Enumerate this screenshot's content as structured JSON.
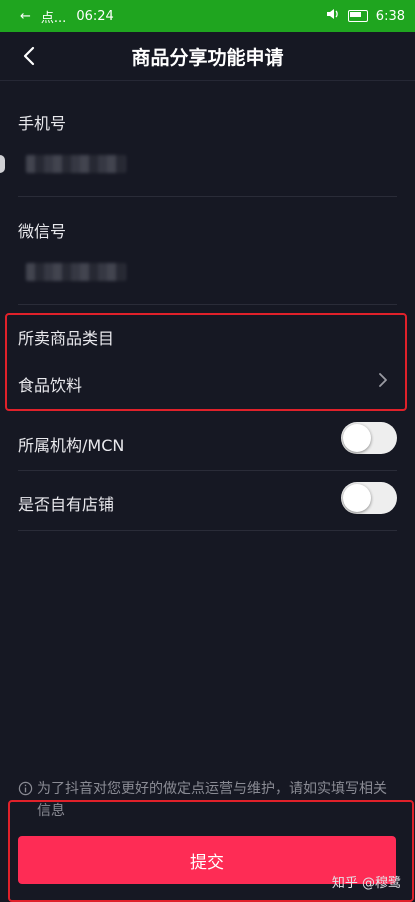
{
  "status_bar": {
    "back_arrow": "←",
    "carrier_text": "点...",
    "time_left": "06:24",
    "time_right": "6:38"
  },
  "header": {
    "title": "商品分享功能申请"
  },
  "form": {
    "phone_label": "手机号",
    "wechat_label": "微信号",
    "category_label": "所卖商品类目",
    "category_value": "食品饮料",
    "mcn_label": "所属机构/MCN",
    "mcn_enabled": false,
    "own_store_label": "是否自有店铺",
    "own_store_enabled": false
  },
  "notice": {
    "text": "为了抖音对您更好的做定点运营与维护，请如实填写相关信息"
  },
  "submit_label": "提交",
  "watermark": "知乎 @穆鹭",
  "colors": {
    "background": "#161823",
    "accent": "#fe2c55",
    "status_bar": "#1fa51f",
    "highlight": "#e0212a"
  },
  "icons": [
    "back-icon",
    "chevron-right-icon",
    "info-icon",
    "battery-icon",
    "volume-icon"
  ]
}
